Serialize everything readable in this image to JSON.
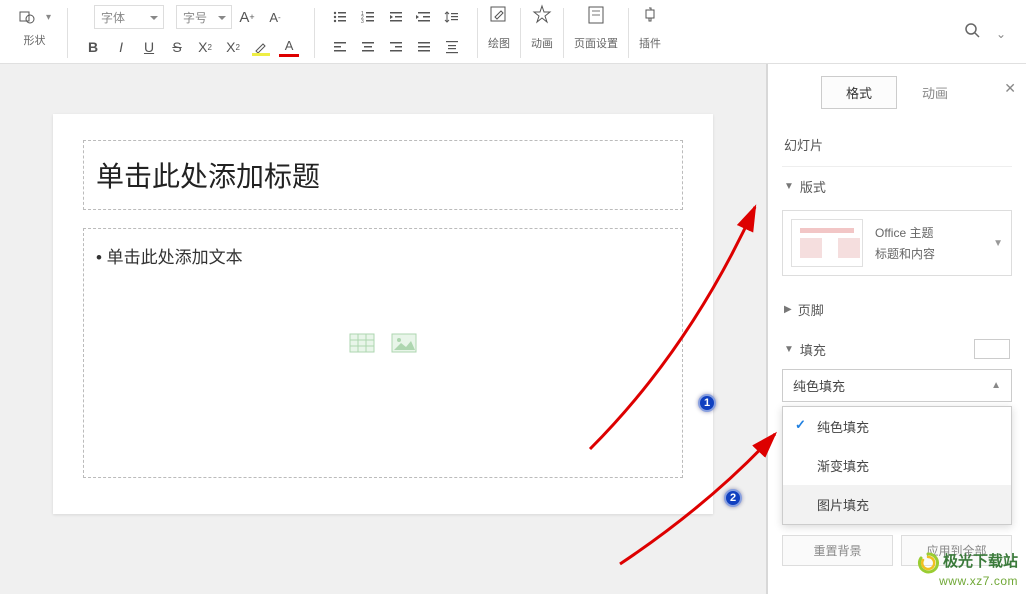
{
  "toolbar": {
    "shape_label": "形状",
    "font_placeholder": "字体",
    "size_placeholder": "字号",
    "draw_label": "绘图",
    "anim_label": "动画",
    "page_setup_label": "页面设置",
    "plugin_label": "插件"
  },
  "slide": {
    "title_placeholder": "单击此处添加标题",
    "content_placeholder": "• 单击此处添加文本"
  },
  "panel": {
    "tab_format": "格式",
    "tab_anim": "动画",
    "section_slide": "幻灯片",
    "section_style": "版式",
    "theme_name": "Office 主题",
    "theme_layout": "标题和内容",
    "section_footer": "页脚",
    "section_fill": "填充",
    "fill_selected": "纯色填充",
    "fill_options": {
      "solid": "纯色填充",
      "gradient": "渐变填充",
      "picture": "图片填充"
    },
    "btn_reset": "重置背景",
    "btn_apply_all": "应用到全部"
  },
  "annotations": {
    "one": "1",
    "two": "2"
  },
  "watermark": {
    "line1": "极光下载站",
    "line2": "www.xz7.com"
  }
}
